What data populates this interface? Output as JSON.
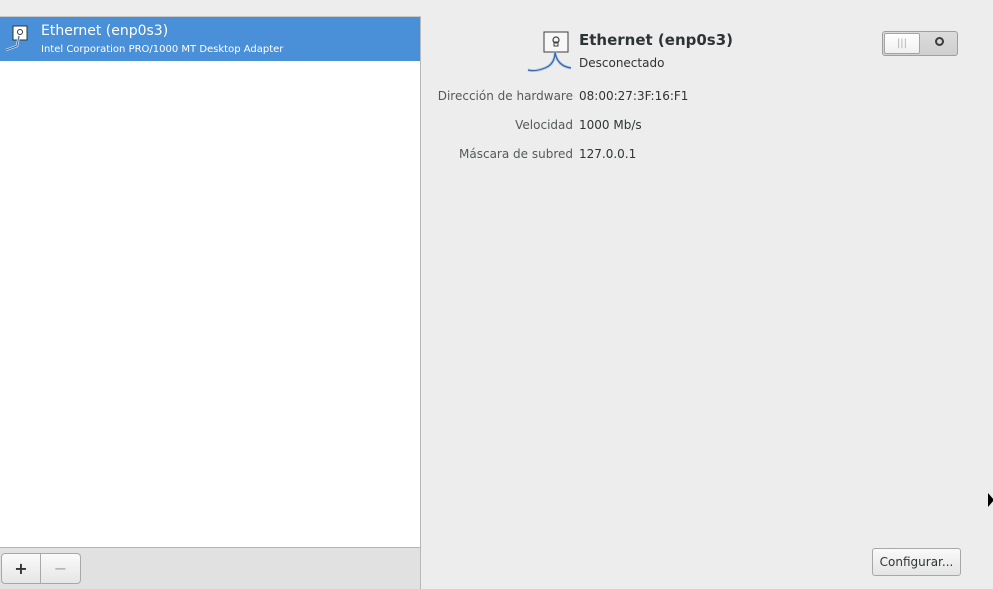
{
  "device_list": {
    "items": [
      {
        "title": "Ethernet (enp0s3)",
        "subtitle": "Intel Corporation PRO/1000 MT Desktop Adapter",
        "icon": "network-wired-icon",
        "selected": true
      }
    ]
  },
  "toolbar": {
    "add_label": "+",
    "remove_label": "−"
  },
  "details": {
    "title": "Ethernet (enp0s3)",
    "status": "Desconectado",
    "switch": {
      "state": "off"
    },
    "properties": [
      {
        "label": "Dirección de hardware",
        "value": "08:00:27:3F:16:F1"
      },
      {
        "label": "Velocidad",
        "value": "1000 Mb/s"
      },
      {
        "label": "Máscara de subred",
        "value": "127.0.0.1"
      }
    ],
    "configure_label": "Configurar..."
  },
  "colors": {
    "selection": "#4a90d9",
    "background": "#ededed"
  }
}
